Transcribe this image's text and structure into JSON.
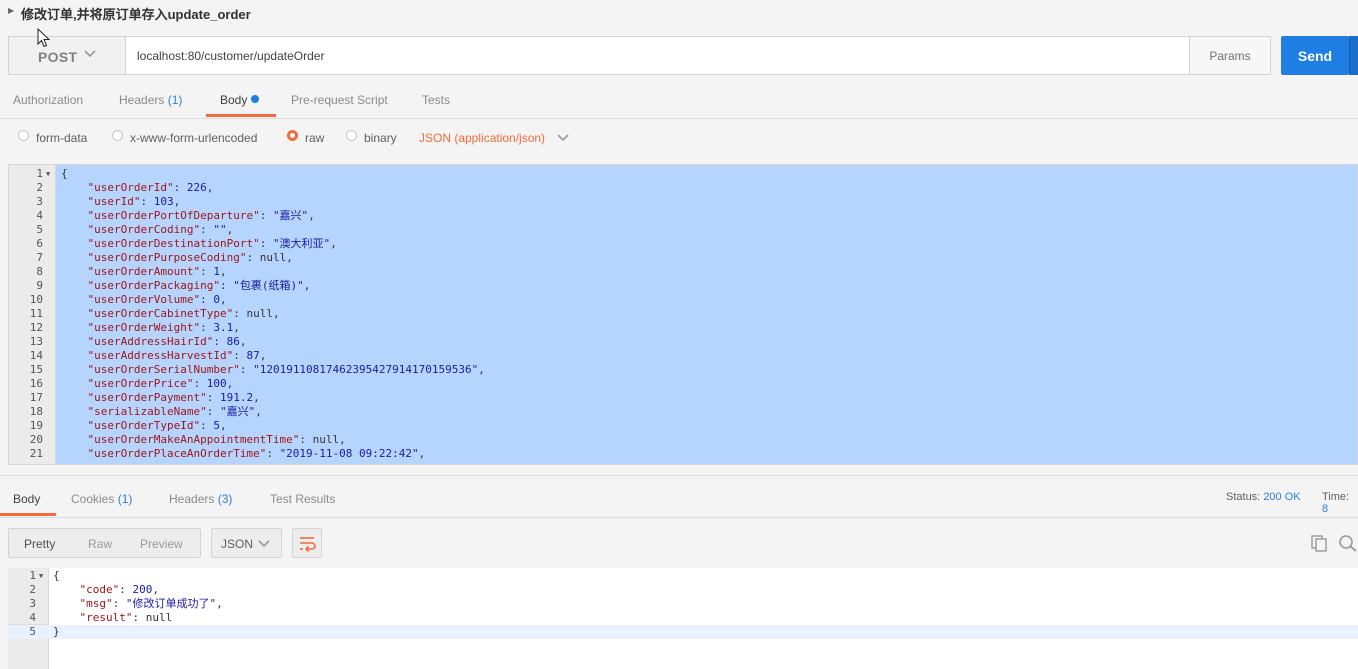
{
  "request": {
    "title": "修改订单,并将原订单存入update_order",
    "method": "POST",
    "url": "localhost:80/customer/updateOrder",
    "params_label": "Params",
    "send_label": "Send"
  },
  "request_tabs": [
    {
      "label": "Authorization",
      "count": ""
    },
    {
      "label": "Headers",
      "count": "(1)"
    },
    {
      "label": "Body",
      "count": ""
    },
    {
      "label": "Pre-request Script",
      "count": ""
    },
    {
      "label": "Tests",
      "count": ""
    }
  ],
  "body_options": {
    "form_data": "form-data",
    "urlencoded": "x-www-form-urlencoded",
    "raw": "raw",
    "binary": "binary",
    "content_type": "JSON (application/json)"
  },
  "request_body_lines": [
    {
      "n": "1",
      "open": "{"
    },
    {
      "n": "2",
      "key": "userOrderId",
      "val": "226",
      "type": "num"
    },
    {
      "n": "3",
      "key": "userId",
      "val": "103",
      "type": "num"
    },
    {
      "n": "4",
      "key": "userOrderPortOfDeparture",
      "val": "\"嘉兴\"",
      "type": "str"
    },
    {
      "n": "5",
      "key": "userOrderCoding",
      "val": "\"\"",
      "type": "str"
    },
    {
      "n": "6",
      "key": "userOrderDestinationPort",
      "val": "\"澳大利亚\"",
      "type": "str"
    },
    {
      "n": "7",
      "key": "userOrderPurposeCoding",
      "val": "null",
      "type": "null"
    },
    {
      "n": "8",
      "key": "userOrderAmount",
      "val": "1",
      "type": "num"
    },
    {
      "n": "9",
      "key": "userOrderPackaging",
      "val": "\"包裹(纸箱)\"",
      "type": "str"
    },
    {
      "n": "10",
      "key": "userOrderVolume",
      "val": "0",
      "type": "num"
    },
    {
      "n": "11",
      "key": "userOrderCabinetType",
      "val": "null",
      "type": "null"
    },
    {
      "n": "12",
      "key": "userOrderWeight",
      "val": "3.1",
      "type": "num"
    },
    {
      "n": "13",
      "key": "userAddressHairId",
      "val": "86",
      "type": "num"
    },
    {
      "n": "14",
      "key": "userAddressHarvestId",
      "val": "87",
      "type": "num"
    },
    {
      "n": "15",
      "key": "userOrderSerialNumber",
      "val": "\"1201911081746239542791417015953​6\"",
      "type": "str"
    },
    {
      "n": "16",
      "key": "userOrderPrice",
      "val": "100",
      "type": "num"
    },
    {
      "n": "17",
      "key": "userOrderPayment",
      "val": "191.2",
      "type": "num"
    },
    {
      "n": "18",
      "key": "serializableName",
      "val": "\"嘉兴\"",
      "type": "str"
    },
    {
      "n": "19",
      "key": "userOrderTypeId",
      "val": "5",
      "type": "num"
    },
    {
      "n": "20",
      "key": "userOrderMakeAnAppointmentTime",
      "val": "null",
      "type": "null"
    },
    {
      "n": "21",
      "key": "userOrderPlaceAnOrderTime",
      "val": "\"2019-11-08 09:22:42\"",
      "type": "str"
    }
  ],
  "response_tabs": [
    {
      "label": "Body",
      "count": ""
    },
    {
      "label": "Cookies",
      "count": "(1)"
    },
    {
      "label": "Headers",
      "count": "(3)"
    },
    {
      "label": "Test Results",
      "count": ""
    }
  ],
  "response_status": {
    "status_label": "Status:",
    "status_value": "200 OK",
    "time_label": "Time:",
    "time_value": "8"
  },
  "response_view": {
    "pretty": "Pretty",
    "raw": "Raw",
    "preview": "Preview",
    "format": "JSON"
  },
  "response_body_lines": [
    {
      "n": "1",
      "text": "{"
    },
    {
      "n": "2",
      "key": "code",
      "val": "200",
      "type": "num"
    },
    {
      "n": "3",
      "key": "msg",
      "val": "\"修改订单成功了\"",
      "type": "str"
    },
    {
      "n": "4",
      "key": "result",
      "val": "null",
      "type": "null",
      "last": true
    },
    {
      "n": "5",
      "text": "}"
    }
  ],
  "colors": {
    "accent_orange": "#f26b3a",
    "send_blue": "#1e7ee3",
    "selection": "#b5d5ff"
  }
}
